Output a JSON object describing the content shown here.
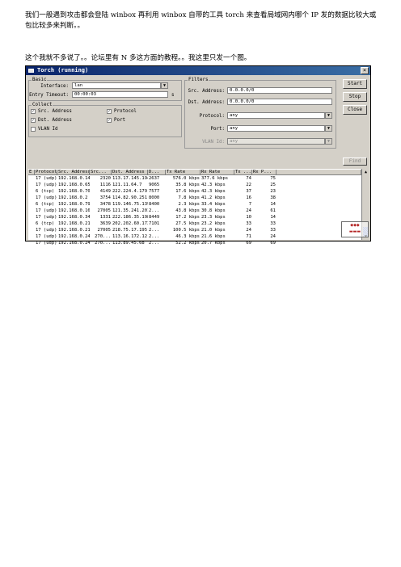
{
  "article": {
    "paragraph1": "我们一般遇到攻击都会登陆 winbox 再利用 winbox 自带的工具 torch 来查看局域网内哪个 IP 发的数据比较大或包比较多来判断。。",
    "paragraph2": "这个我就不多说了。。论坛里有 N 多这方面的教程。。我这里只发一个图。"
  },
  "window": {
    "title": "Torch (running)",
    "close_glyph": "×"
  },
  "basic": {
    "legend": "Basic",
    "interface_label": "Interface:",
    "interface_value": "lan",
    "entry_timeout_label": "Entry Timeout:",
    "entry_timeout_value": "00:00:03",
    "entry_timeout_suffix": "s"
  },
  "collect": {
    "legend": "Collect",
    "items": [
      {
        "label": "Src. Address",
        "checked": true
      },
      {
        "label": "Protocol",
        "checked": true
      },
      {
        "label": "Dst. Address",
        "checked": true
      },
      {
        "label": "Port",
        "checked": true
      },
      {
        "label": "VLAN Id",
        "checked": false
      }
    ]
  },
  "filters": {
    "legend": "Filters",
    "src_label": "Src. Address:",
    "src_value": "0.0.0.0/0",
    "dst_label": "Dst. Address:",
    "dst_value": "0.0.0.0/0",
    "protocol_label": "Protocol:",
    "protocol_value": "any",
    "port_label": "Port:",
    "port_value": "any",
    "vlan_label": "VLAN Id:",
    "vlan_value": "any"
  },
  "buttons": {
    "start": "Start",
    "stop": "Stop",
    "close": "Close",
    "find": "Find"
  },
  "icons": {
    "dropdown": "▼",
    "check": "✓",
    "scroll_up": "▲",
    "scroll_down": "▼"
  },
  "table": {
    "columns": [
      "E",
      "Protocol",
      "Src. Address",
      "Src...",
      "Dst. Address",
      "D...",
      "Tx Rate",
      "Rx Rate",
      "Tx ...",
      "Rx P...",
      ""
    ],
    "rows": [
      [
        "",
        "17 (udp)",
        "192.168.0.145",
        "2320",
        "113.17.145.194",
        "2637",
        "576.0 kbps",
        "377.6 kbps",
        "74",
        "75"
      ],
      [
        "",
        "17 (udp)",
        "192.168.0.65",
        "1116",
        "121.11.64.7",
        "9065",
        "35.8 kbps",
        "42.3 kbps",
        "22",
        "25"
      ],
      [
        "",
        "6 (tcp)",
        "192.168.0.70",
        "4149",
        "222.224.4.179",
        "7577",
        "17.6 kbps",
        "42.3 kbps",
        "37",
        "23"
      ],
      [
        "",
        "17 (udp)",
        "192.168.0.2",
        "3754",
        "114.82.90.251",
        "8000",
        "7.8 kbps",
        "41.2 kbps",
        "16",
        "38"
      ],
      [
        "",
        "6 (tcp)",
        "192.168.0.79",
        "3478",
        "119.146.75.139",
        "8400",
        "2.3 kbps",
        "33.4 kbps",
        "7",
        "14"
      ],
      [
        "",
        "17 (udp)",
        "192.168.0.161",
        "27005",
        "121.35.241.201",
        "2...",
        "43.8 kbps",
        "30.8 kbps",
        "24",
        "61"
      ],
      [
        "",
        "17 (udp)",
        "192.168.0.34",
        "1331",
        "222.186.35.198",
        "8449",
        "17.2 kbps",
        "23.3 kbps",
        "10",
        "14"
      ],
      [
        "",
        "6 (tcp)",
        "192.168.0.218",
        "3639",
        "202.202.60.173",
        "7101",
        "27.5 kbps",
        "23.2 kbps",
        "33",
        "33"
      ],
      [
        "",
        "17 (udp)",
        "192.168.0.219",
        "27005",
        "218.75.17.195",
        "2...",
        "100.5 kbps",
        "21.0 kbps",
        "24",
        "33"
      ],
      [
        "",
        "17 (udp)",
        "192.168.0.247",
        "270...",
        "113.16.172.12",
        "2...",
        "46.3 kbps",
        "21.6 kbps",
        "71",
        "24"
      ],
      [
        "",
        "17 (udp)",
        "192.168.0.247",
        "270...",
        "113.89.45.68",
        "2...",
        "52.2 kbps",
        "20.7 kbps",
        "69",
        "69"
      ]
    ]
  }
}
